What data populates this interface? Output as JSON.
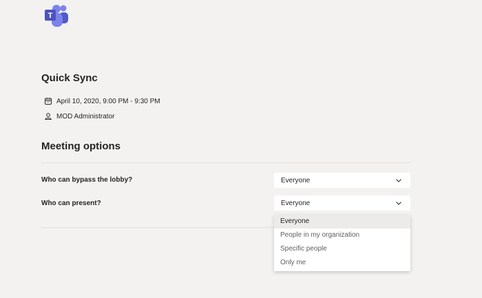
{
  "app": {
    "logo": "teams-logo"
  },
  "meeting": {
    "title": "Quick Sync",
    "date_time": "April 10, 2020, 9:00 PM - 9:30 PM",
    "date_icon": "calendar-icon",
    "organizer": "MOD Administrator",
    "organizer_icon": "person-icon"
  },
  "options": {
    "section_title": "Meeting options",
    "lobby": {
      "label": "Who can bypass the lobby?",
      "value": "Everyone"
    },
    "present": {
      "label": "Who can present?",
      "value": "Everyone",
      "choices": [
        {
          "label": "Everyone",
          "selected": true
        },
        {
          "label": "People in my organization",
          "selected": false
        },
        {
          "label": "Specific people",
          "selected": false
        },
        {
          "label": "Only me",
          "selected": false
        }
      ]
    }
  },
  "colors": {
    "background": "#f3f2f1",
    "teams_purple": "#5b5fc7",
    "text": "#252423",
    "muted_text": "#605e5c"
  }
}
